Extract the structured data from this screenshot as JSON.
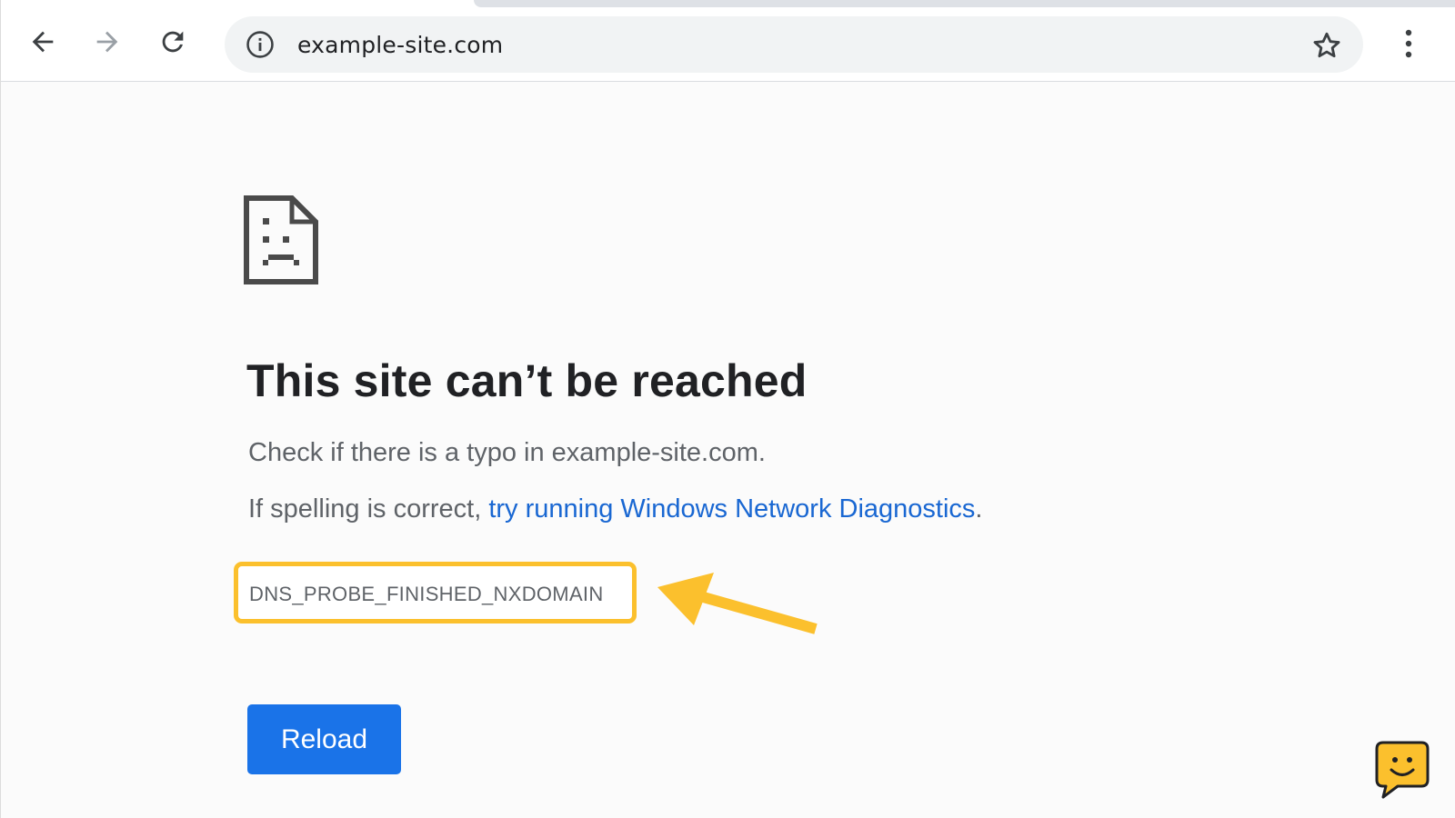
{
  "browser": {
    "url": "example-site.com",
    "icons": {
      "back": "arrow-left",
      "forward": "arrow-right",
      "reload": "reload",
      "site_info": "info-circle",
      "bookmark": "star-outline",
      "menu": "three-dots-vertical"
    }
  },
  "error_page": {
    "icon": "sad-document",
    "headline": "This site can’t be reached",
    "line1": "Check if there is a typo in example-site.com.",
    "line2_prefix": "If spelling is correct, ",
    "line2_link": "try running Windows Network Diagnostics",
    "line2_suffix": ".",
    "error_code": "DNS_PROBE_FINISHED_NXDOMAIN",
    "reload_button": "Reload"
  },
  "annotations": {
    "highlight_color": "#fbc02d",
    "arrow_color": "#fbc02d",
    "chat_widget_icon": "smiley-speech-bubble"
  },
  "colors": {
    "accent": "#1a73e8",
    "link": "#1967d2",
    "text_primary": "#202124",
    "text_secondary": "#5f6368"
  }
}
